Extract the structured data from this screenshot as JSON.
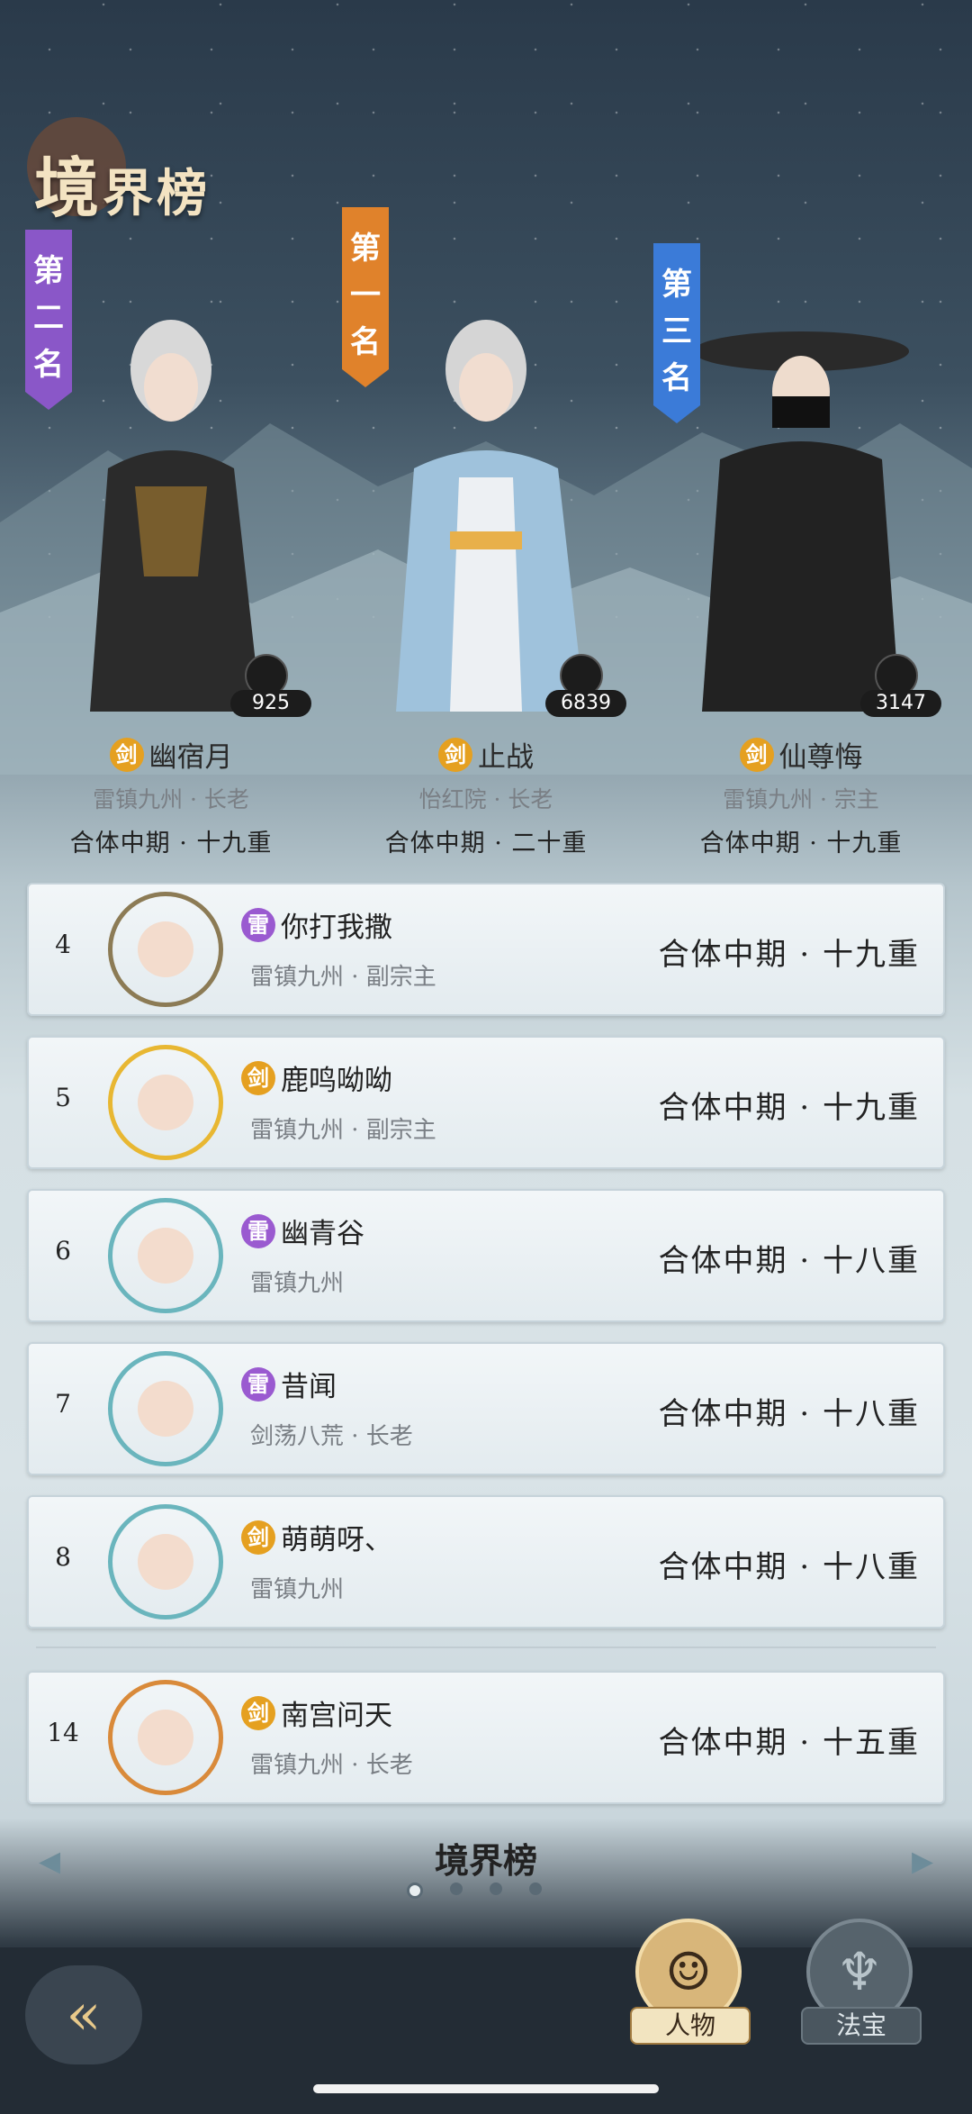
{
  "page": {
    "title_big": "境",
    "title_rest": "界榜"
  },
  "top3": [
    {
      "place_label": "第二名",
      "name": "幽宿月",
      "sect": "剑",
      "affiliation": "雷镇九州 · 长老",
      "realm": "合体中期 · 十九重",
      "count": "925"
    },
    {
      "place_label": "第一名",
      "name": "止战",
      "sect": "剑",
      "affiliation": "怡红院 · 长老",
      "realm": "合体中期 · 二十重",
      "count": "6839"
    },
    {
      "place_label": "第三名",
      "name": "仙尊悔",
      "sect": "剑",
      "affiliation": "雷镇九州 · 宗主",
      "realm": "合体中期 · 十九重",
      "count": "3147"
    }
  ],
  "ranking": [
    {
      "rank": "4",
      "sect": "雷",
      "name": "你打我撒",
      "affiliation": "雷镇九州 · 副宗主",
      "realm": "合体中期 · 十九重"
    },
    {
      "rank": "5",
      "sect": "剑",
      "name": "鹿鸣呦呦",
      "affiliation": "雷镇九州 · 副宗主",
      "realm": "合体中期 · 十九重"
    },
    {
      "rank": "6",
      "sect": "雷",
      "name": "幽青谷",
      "affiliation": "雷镇九州",
      "realm": "合体中期 · 十八重"
    },
    {
      "rank": "7",
      "sect": "雷",
      "name": "昔闻",
      "affiliation": "剑荡八荒 · 长老",
      "realm": "合体中期 · 十八重"
    },
    {
      "rank": "8",
      "sect": "剑",
      "name": "萌萌呀、",
      "affiliation": "雷镇九州",
      "realm": "合体中期 · 十八重"
    }
  ],
  "self": {
    "rank": "14",
    "sect": "剑",
    "name": "南宫问天",
    "affiliation": "雷镇九州 · 长老",
    "realm": "合体中期 · 十五重"
  },
  "nav": {
    "title": "境界榜",
    "page_count": 4,
    "active_page": 1
  },
  "tabs": {
    "person": "人物",
    "treasure": "法宝"
  },
  "colors": {
    "sword_sect": "#e5a020",
    "thunder_sect": "#9a5ad0",
    "first_banner": "#e0822b",
    "second_banner": "#8a57c8",
    "third_banner": "#3b7bd8"
  },
  "icons": {
    "back": "back-arrow-icon",
    "prev": "chevron-left-icon",
    "next": "chevron-right-icon",
    "person_tab": "person-silhouette-icon",
    "treasure_tab": "gourd-icon"
  }
}
